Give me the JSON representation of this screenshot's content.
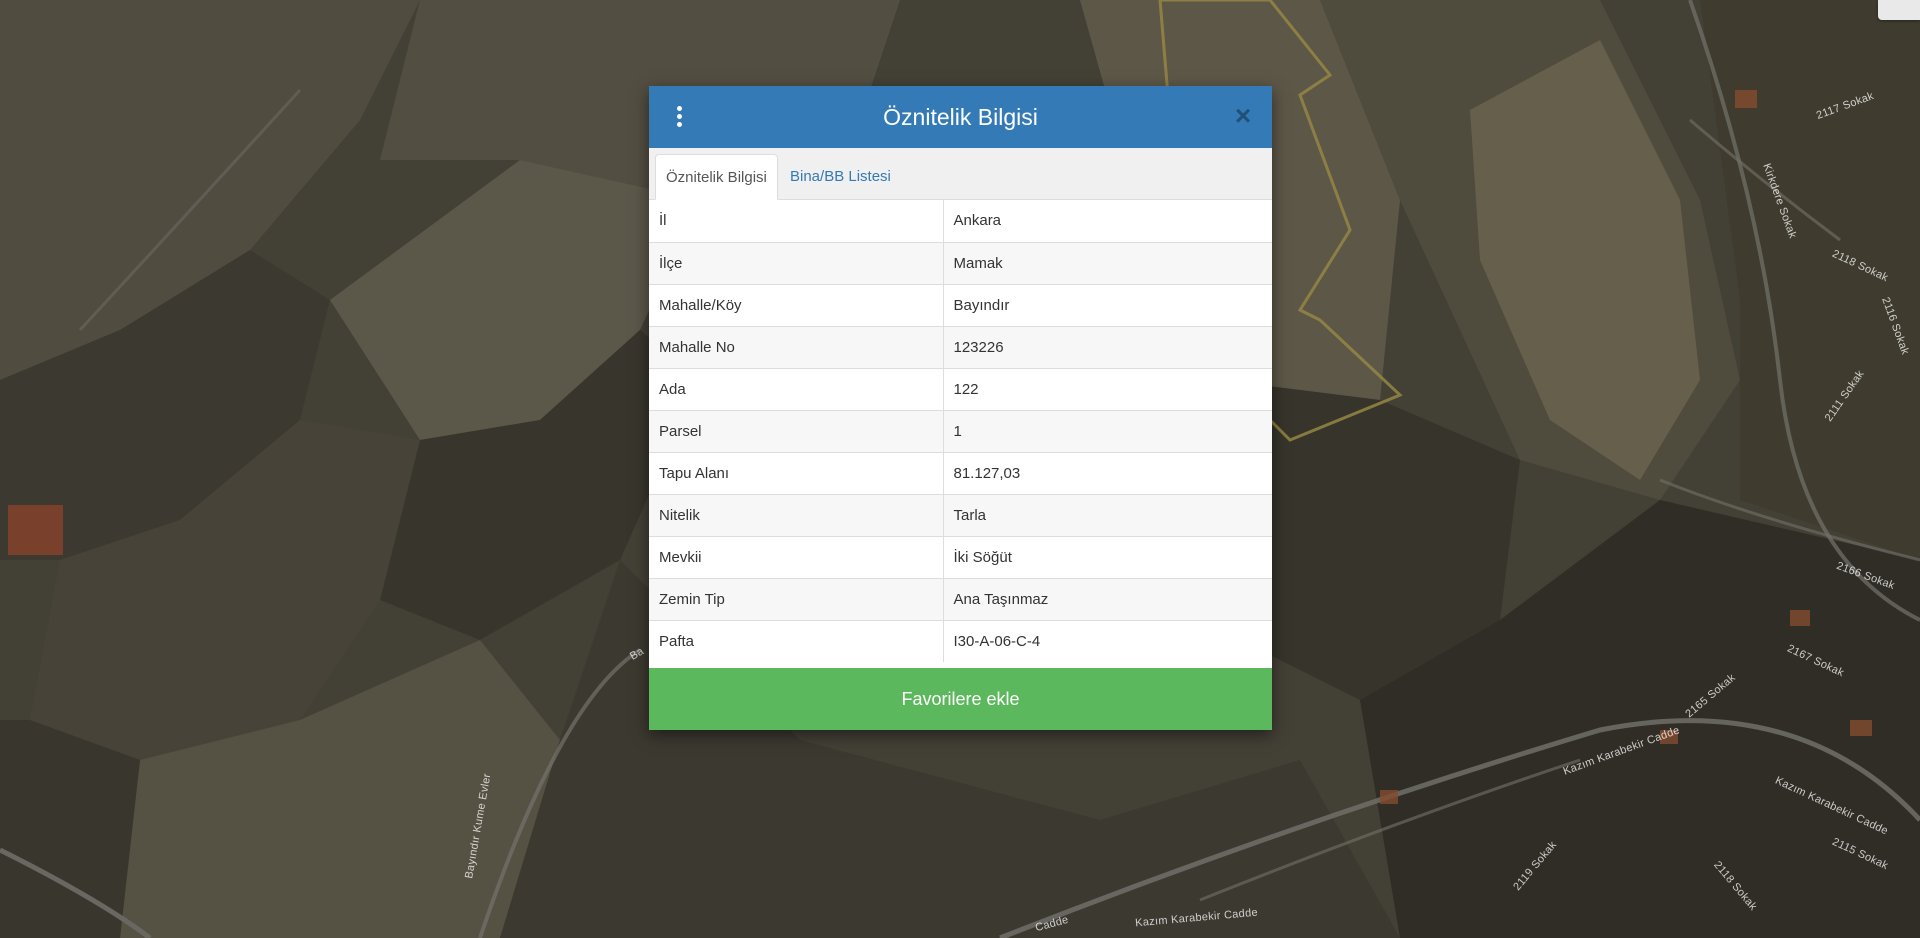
{
  "map": {
    "road_labels": [
      "2117 Sokak",
      "Kirkdere Sokak",
      "2118 Sokak",
      "2116 Sokak",
      "2111 Sokak",
      "2166 Sokak",
      "2167 Sokak",
      "2165 Sokak",
      "Kazım Karabekir Cadde",
      "Kazım Karabekir Cadde",
      "Kazım Karabekir Cadde",
      "2119 Sokak",
      "2115 Sokak",
      "2118 Sokak",
      "Bayındır Kume Evler",
      "Cadde",
      "Ba"
    ]
  },
  "modal": {
    "title": "Öznitelik Bilgisi",
    "menu_icon": "vertical-dots-icon",
    "close_icon": "close-icon",
    "close_glyph": "×",
    "tabs": [
      {
        "label": "Öznitelik Bilgisi",
        "active": true
      },
      {
        "label": "Bina/BB Listesi",
        "active": false
      }
    ],
    "rows": [
      {
        "key": "İl",
        "value": "Ankara"
      },
      {
        "key": "İlçe",
        "value": "Mamak"
      },
      {
        "key": "Mahalle/Köy",
        "value": "Bayındır"
      },
      {
        "key": "Mahalle No",
        "value": "123226"
      },
      {
        "key": "Ada",
        "value": "122"
      },
      {
        "key": "Parsel",
        "value": "1"
      },
      {
        "key": "Tapu Alanı",
        "value": "81.127,03"
      },
      {
        "key": "Nitelik",
        "value": "Tarla"
      },
      {
        "key": "Mevkii",
        "value": "İki Söğüt"
      },
      {
        "key": "Zemin Tip",
        "value": "Ana Taşınmaz"
      },
      {
        "key": "Pafta",
        "value": "I30-A-06-C-4"
      }
    ],
    "favorite_button": "Favorilere ekle"
  },
  "colors": {
    "header": "#337ab7",
    "favorite": "#5cb85c",
    "parcel_outline": "#c8b45a"
  }
}
